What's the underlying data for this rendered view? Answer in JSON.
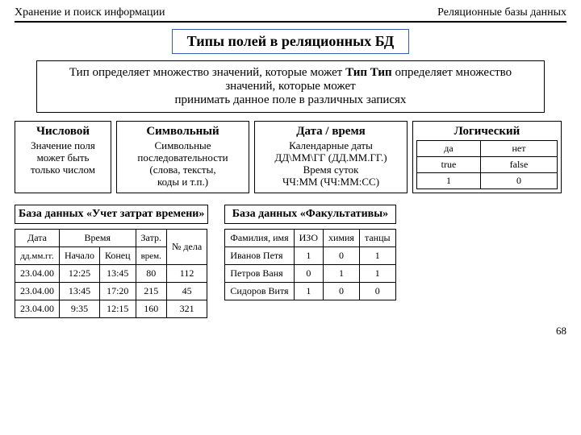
{
  "header": {
    "left": "Хранение и поиск информации",
    "right": "Реляционные базы данных"
  },
  "title": "Типы полей в реляционных БД",
  "desc_l1": "Тип определяет множество значений, которые может",
  "desc_l2": "принимать данное поле в различных записях",
  "types": {
    "numeric": {
      "h": "Числовой",
      "d1": "Значение поля",
      "d2": "может быть",
      "d3": "только числом"
    },
    "symbol": {
      "h": "Символьный",
      "d1": "Символьные",
      "d2": "последовательности",
      "d3": "(слова, тексты,",
      "d4": "коды и т.п.)"
    },
    "date": {
      "h": "Дата / время",
      "d1": "Календарные даты",
      "d2": "ДД\\ММ\\ГГ (ДД.ММ.ГГ.)",
      "d3": "Время суток",
      "d4": "ЧЧ:ММ (ЧЧ:ММ:СС)"
    },
    "logic": {
      "h": "Логический",
      "r1c1": "да",
      "r1c2": "нет",
      "r2c1": "true",
      "r2c2": "false",
      "r3c1": "1",
      "r3c2": "0"
    }
  },
  "db1": {
    "title": "База данных «Учет затрат времени»",
    "h_date": "Дата",
    "h_date_sub": "дд.мм.гг.",
    "h_time": "Время",
    "h_start": "Начало",
    "h_end": "Конец",
    "h_spent": "Затр.",
    "h_spent_sub": "врем.",
    "h_case": "№ дела",
    "rows": [
      {
        "date": "23.04.00",
        "start": "12:25",
        "end": "13:45",
        "spent": "80",
        "case": "112"
      },
      {
        "date": "23.04.00",
        "start": "13:45",
        "end": "17:20",
        "spent": "215",
        "case": "45"
      },
      {
        "date": "23.04.00",
        "start": "9:35",
        "end": "12:15",
        "spent": "160",
        "case": "321"
      }
    ]
  },
  "db2": {
    "title": "База данных «Факультативы»",
    "h_name": "Фамилия, имя",
    "h_izo": "ИЗО",
    "h_chem": "химия",
    "h_dance": "танцы",
    "rows": [
      {
        "name": "Иванов Петя",
        "izo": "1",
        "chem": "0",
        "dance": "1"
      },
      {
        "name": "Петров Ваня",
        "izo": "0",
        "chem": "1",
        "dance": "1"
      },
      {
        "name": "Сидоров Витя",
        "izo": "1",
        "chem": "0",
        "dance": "0"
      }
    ]
  },
  "page": "68"
}
